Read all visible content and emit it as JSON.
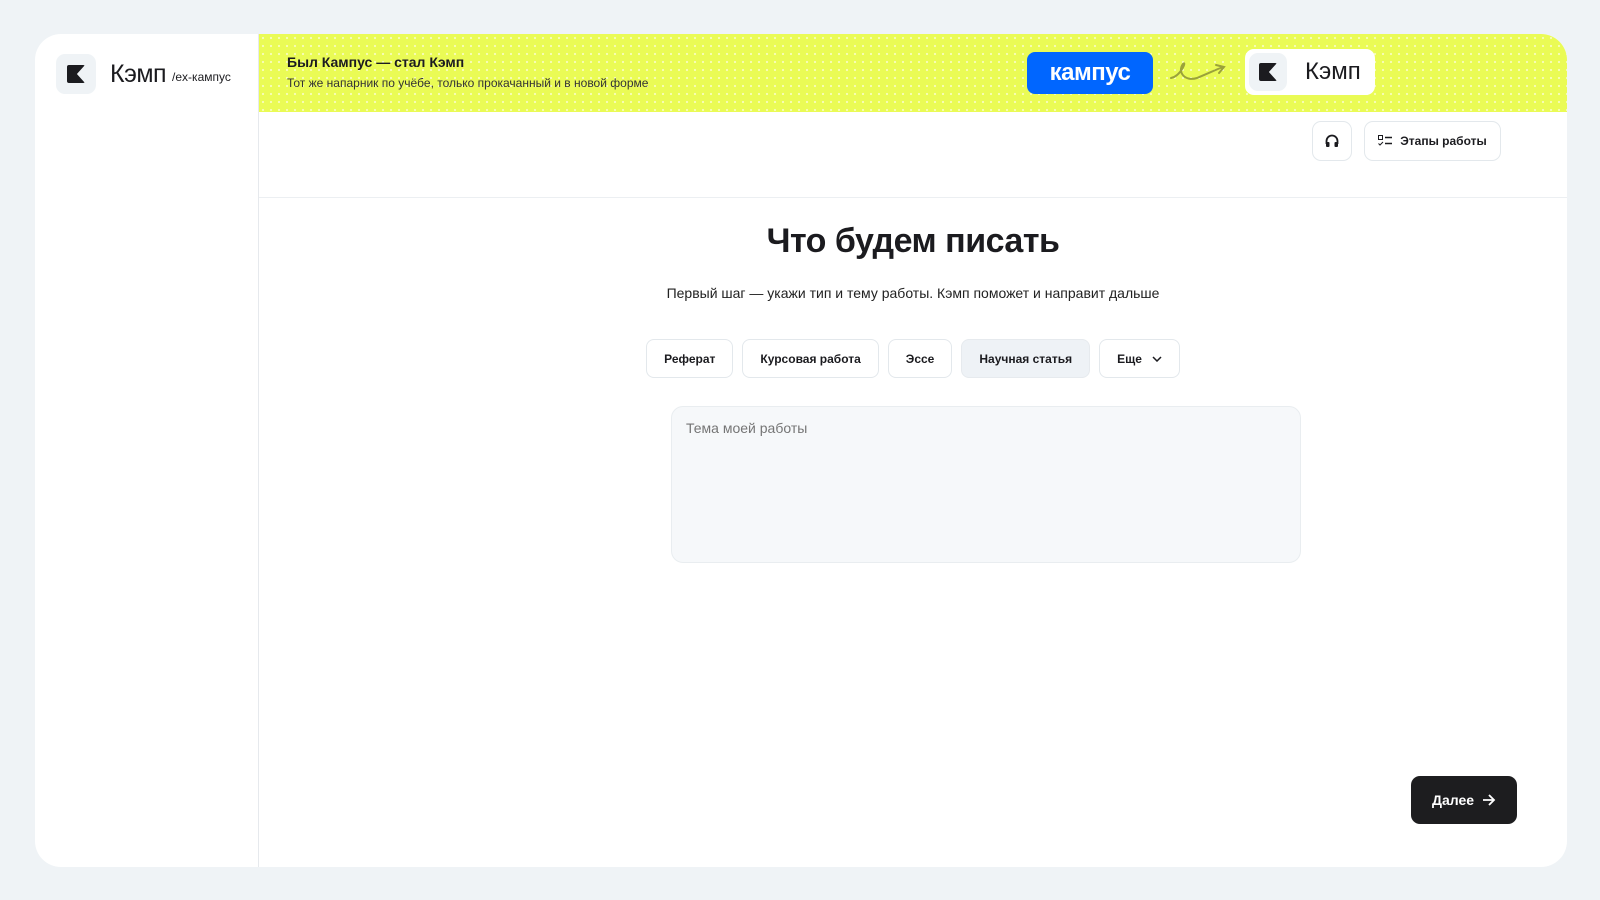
{
  "sidebar": {
    "logo_name": "Кэмп",
    "logo_ex": "/ex-кампус"
  },
  "banner": {
    "title": "Был Кампус — стал Кэмп",
    "subtitle": "Тот же напарник по учёбе, только прокачанный и в новой форме",
    "old_brand": "кампус",
    "new_brand": "Кэмп"
  },
  "toolbar": {
    "stages_label": "Этапы работы"
  },
  "main": {
    "title": "Что будем писать",
    "subtitle": "Первый шаг — укажи тип и тему работы. Кэмп поможет и направит дальше",
    "types": [
      {
        "label": "Реферат"
      },
      {
        "label": "Курсовая работа"
      },
      {
        "label": "Эссе"
      },
      {
        "label": "Научная статья",
        "selected": true
      }
    ],
    "more_label": "Еще",
    "topic_placeholder": "Тема моей работы",
    "topic_value": "",
    "next_label": "Далее"
  },
  "colors": {
    "banner": "#eafb55",
    "kampus_blue": "#0066ff",
    "dark": "#1d1d1f"
  }
}
